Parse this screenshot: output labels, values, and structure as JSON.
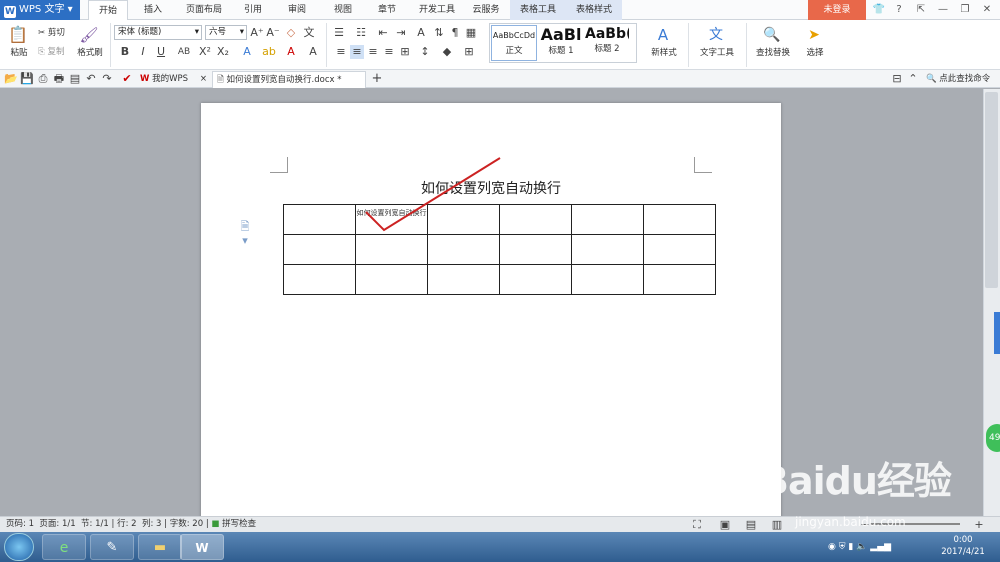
{
  "app": {
    "name": "WPS 文字",
    "login": "未登录"
  },
  "menu_tabs": [
    "开始",
    "插入",
    "页面布局",
    "引用",
    "审阅",
    "视图",
    "章节",
    "开发工具",
    "云服务",
    "表格工具",
    "表格样式"
  ],
  "ribbon": {
    "paste": "粘贴",
    "cut": "剪切",
    "copy": "复制",
    "format_painter": "格式刷",
    "font_name": "宋体 (标题)",
    "font_size": "六号",
    "styles": [
      {
        "preview": "AaBbCcDd",
        "label": "正文"
      },
      {
        "preview": "AaBl",
        "label": "标题 1"
      },
      {
        "preview": "AaBb(",
        "label": "标题 2"
      }
    ],
    "new_style": "新样式",
    "text_tools": "文字工具",
    "find_replace": "查找替换",
    "select": "选择"
  },
  "doc_tabs": [
    {
      "label": "我的WPS"
    },
    {
      "label": "如何设置列宽自动换行.docx *"
    }
  ],
  "search_cmd": "点此查找命令",
  "document": {
    "title": "如何设置列宽自动换行",
    "table": [
      [
        "如何设置列宽自动换行",
        "",
        "",
        "",
        "",
        ""
      ],
      [
        "",
        "",
        "",
        "",
        "",
        ""
      ],
      [
        "",
        "",
        "",
        "",
        "",
        ""
      ]
    ]
  },
  "status": {
    "page_num": "页码: 1",
    "pages": "页面: 1/1",
    "section": "节: 1/1",
    "row": "行: 2",
    "col": "列: 3",
    "words": "字数: 20",
    "spell": "拼写检查"
  },
  "taskbar": {
    "time": "0:00",
    "date": "2017/4/21"
  },
  "watermark": {
    "text": "Baidu经验",
    "url": "jingyan.baidu.com"
  },
  "side_badge": "49",
  "colors": {
    "accent": "#2c6fc4",
    "login": "#e8684a",
    "annotation": "#cc2222"
  }
}
